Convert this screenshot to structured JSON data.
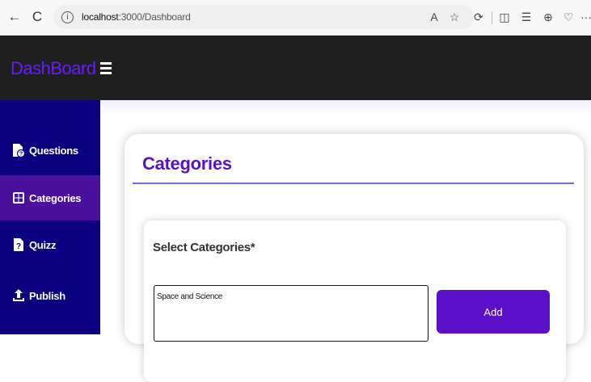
{
  "browser": {
    "back_icon": "←",
    "refresh_icon": "C",
    "info_icon": "i",
    "url_host": "localhost",
    "url_path": ":3000/Dashboard",
    "toolbar_icons": {
      "read_aloud": "A",
      "favorite": "☆",
      "extensions": "⟳",
      "split": "◫",
      "favorites_list": "☰",
      "collections": "⊕",
      "health": "♡",
      "more": "···"
    }
  },
  "header": {
    "brand": "DashBoard"
  },
  "sidebar": {
    "items": [
      {
        "label": "Questions",
        "icon": "question-doc-icon"
      },
      {
        "label": "Categories",
        "icon": "grid-icon",
        "active": true
      },
      {
        "label": "Quizz",
        "icon": "quiz-doc-icon"
      },
      {
        "label": "Publish",
        "icon": "upload-icon"
      }
    ]
  },
  "main": {
    "title": "Categories",
    "form": {
      "label": "Select Categories*",
      "input_value": "Space and Science",
      "add_label": "Add"
    }
  },
  "colors": {
    "brand": "#6a1cff",
    "sidebar": "#0b0080",
    "active_item": "#4a129c",
    "title": "#5a0fc8",
    "button": "#5b0fc8"
  }
}
